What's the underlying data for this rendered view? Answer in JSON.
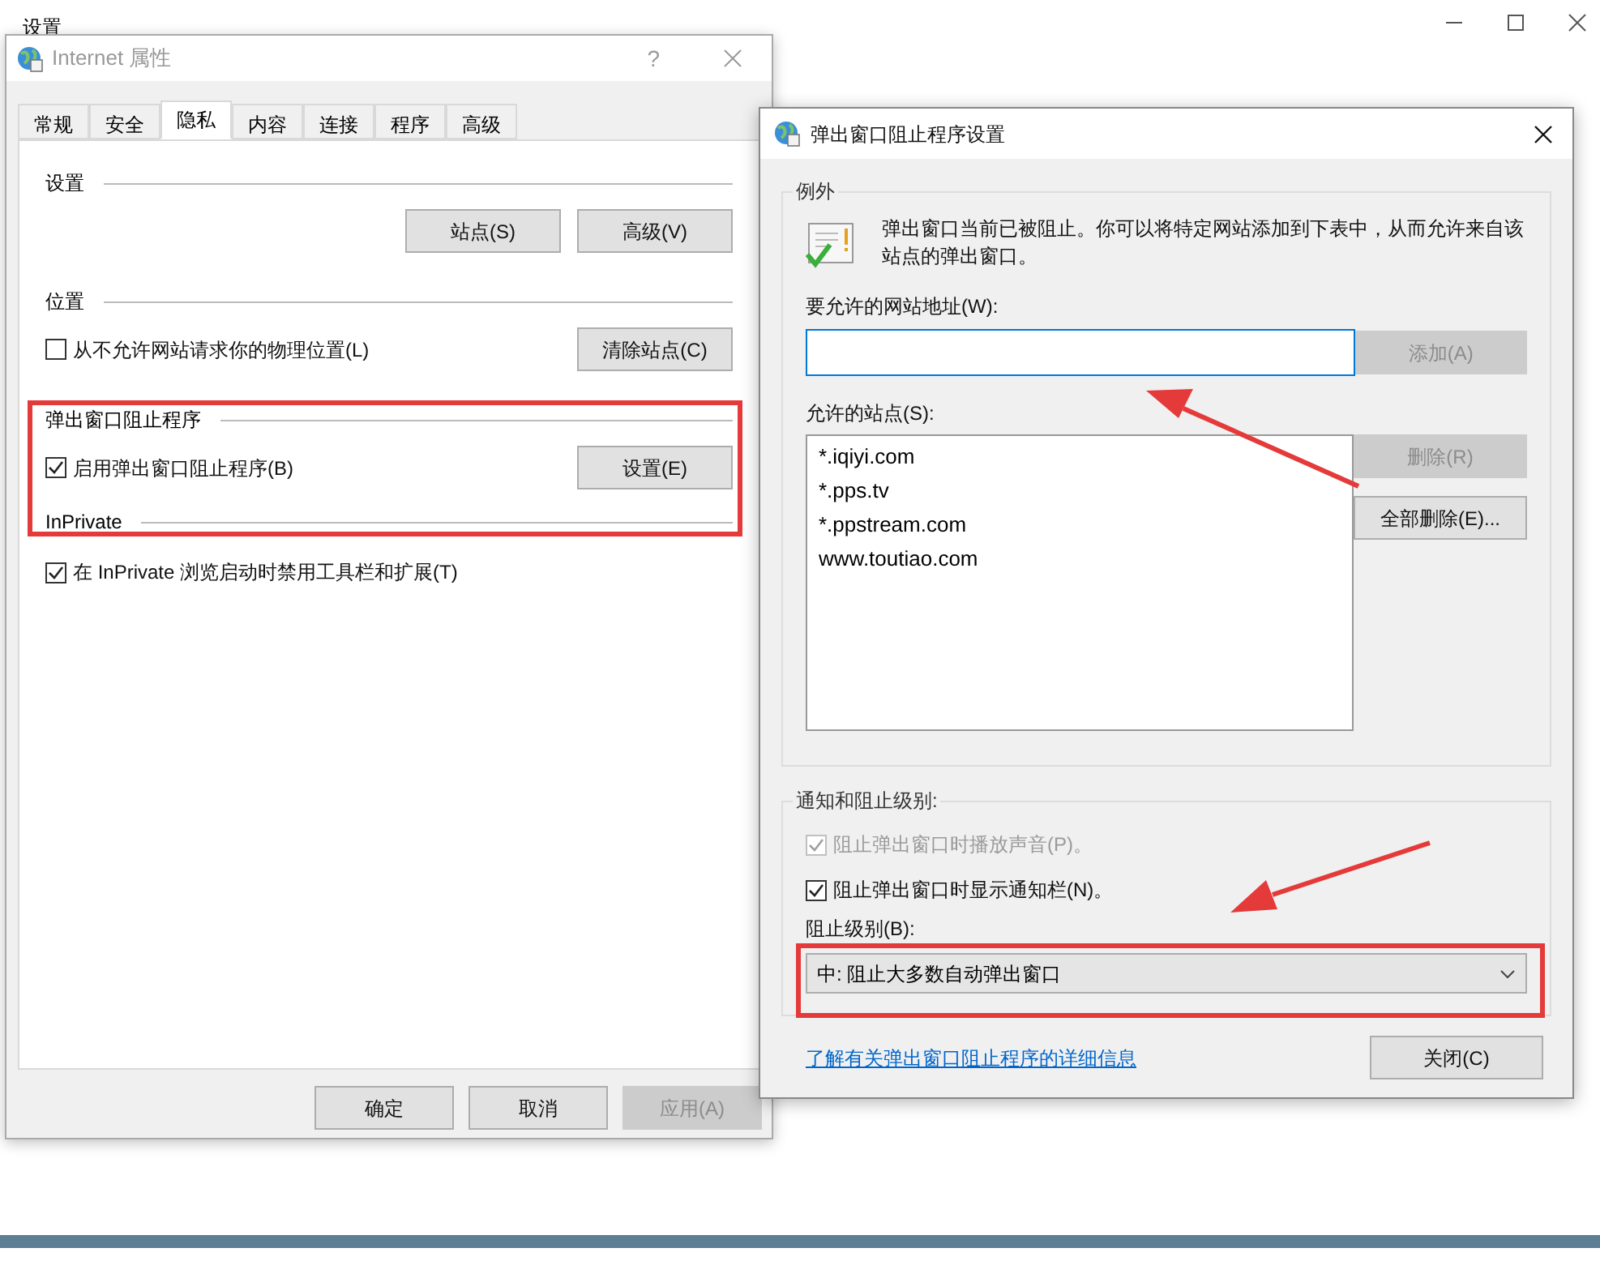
{
  "background_window": {
    "title": "设置"
  },
  "internet_options": {
    "title": "Internet 属性",
    "help": "?",
    "tabs": [
      {
        "label": "常规",
        "selected": false
      },
      {
        "label": "安全",
        "selected": false
      },
      {
        "label": "隐私",
        "selected": true
      },
      {
        "label": "内容",
        "selected": false
      },
      {
        "label": "连接",
        "selected": false
      },
      {
        "label": "程序",
        "selected": false
      },
      {
        "label": "高级",
        "selected": false
      }
    ],
    "sections": [
      {
        "title": "设置",
        "buttons": [
          "站点(S)",
          "高级(V)"
        ]
      },
      {
        "title": "位置",
        "checkbox": {
          "label": "从不允许网站请求你的物理位置(L)",
          "checked": false
        },
        "buttons": [
          "清除站点(C)"
        ]
      },
      {
        "title": "弹出窗口阻止程序",
        "checkbox": {
          "label": "启用弹出窗口阻止程序(B)",
          "checked": true
        },
        "buttons": [
          "设置(E)"
        ]
      },
      {
        "title": "InPrivate",
        "checkbox": {
          "label": "在 InPrivate 浏览启动时禁用工具栏和扩展(T)",
          "checked": true
        }
      }
    ],
    "footer_buttons": [
      {
        "label": "确定",
        "disabled": false
      },
      {
        "label": "取消",
        "disabled": false
      },
      {
        "label": "应用(A)",
        "disabled": true
      }
    ]
  },
  "popup_settings": {
    "title": "弹出窗口阻止程序设置",
    "exceptions": {
      "title": "例外",
      "message": "弹出窗口当前已被阻止。你可以将特定网站添加到下表中，从而允许来自该站点的弹出窗口。",
      "address_label": "要允许的网站地址(W):",
      "add_button": {
        "label": "添加(A)",
        "disabled": true
      },
      "sites_label": "允许的站点(S):",
      "sites": [
        "*.iqiyi.com",
        "*.pps.tv",
        "*.ppstream.com",
        "www.toutiao.com"
      ],
      "remove_button": {
        "label": "删除(R)",
        "disabled": true
      },
      "remove_all_button": {
        "label": "全部删除(E)...",
        "disabled": false
      }
    },
    "notifications": {
      "title": "通知和阻止级别:",
      "options": [
        {
          "label": "阻止弹出窗口时播放声音(P)。",
          "checked": true,
          "disabled": true
        },
        {
          "label": "阻止弹出窗口时显示通知栏(N)。",
          "checked": true,
          "disabled": false
        }
      ],
      "level_label": "阻止级别(B):",
      "level_value": "中: 阻止大多数自动弹出窗口"
    },
    "link": "了解有关弹出窗口阻止程序的详细信息",
    "close_button": "关闭(C)"
  }
}
